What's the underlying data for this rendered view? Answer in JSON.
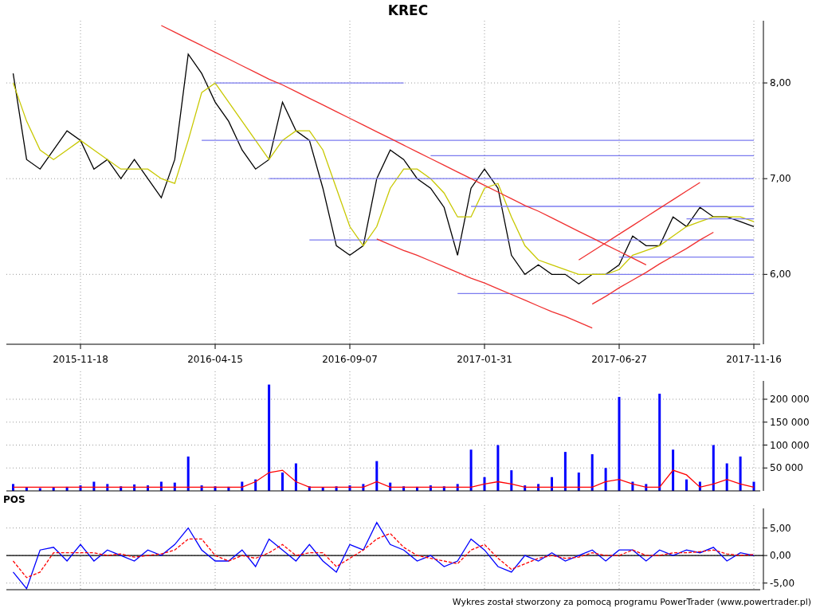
{
  "price": {
    "chart_data": {
      "type": "line",
      "title": "KREC",
      "grid": true,
      "categories": [
        null,
        null,
        null,
        null,
        null,
        "2015-11-18",
        null,
        null,
        null,
        null,
        null,
        null,
        null,
        null,
        null,
        "2016-04-15",
        null,
        null,
        null,
        null,
        null,
        null,
        null,
        null,
        null,
        "2016-09-07",
        null,
        null,
        null,
        null,
        null,
        null,
        null,
        null,
        null,
        "2017-01-31",
        null,
        null,
        null,
        null,
        null,
        null,
        null,
        null,
        null,
        "2017-06-27",
        null,
        null,
        null,
        null,
        null,
        null,
        null,
        null,
        null,
        "2017-11-16"
      ],
      "series": [
        {
          "color": "#000000",
          "values": [
            8.1,
            7.2,
            7.1,
            7.3,
            7.5,
            7.4,
            7.1,
            7.2,
            7.0,
            7.2,
            7.0,
            6.8,
            7.2,
            8.3,
            8.1,
            7.8,
            7.6,
            7.3,
            7.1,
            7.2,
            7.8,
            7.5,
            7.4,
            6.9,
            6.3,
            6.2,
            6.3,
            7.0,
            7.3,
            7.2,
            7.0,
            6.9,
            6.7,
            6.2,
            6.9,
            7.1,
            6.9,
            6.2,
            6.0,
            6.1,
            6.0,
            6.0,
            5.9,
            6.0,
            6.0,
            6.1,
            6.4,
            6.3,
            6.3,
            6.6,
            6.5,
            6.7,
            6.6,
            6.6,
            6.55,
            6.5
          ]
        },
        {
          "color": "#c8c800",
          "values": [
            8.0,
            7.6,
            7.3,
            7.2,
            7.3,
            7.4,
            7.3,
            7.2,
            7.1,
            7.1,
            7.1,
            7.0,
            6.95,
            7.4,
            7.9,
            8.0,
            7.8,
            7.6,
            7.4,
            7.2,
            7.4,
            7.5,
            7.5,
            7.3,
            6.9,
            6.5,
            6.3,
            6.5,
            6.9,
            7.1,
            7.1,
            7.0,
            6.85,
            6.6,
            6.6,
            6.9,
            6.95,
            6.6,
            6.3,
            6.15,
            6.1,
            6.05,
            6.0,
            6.0,
            6.0,
            6.05,
            6.2,
            6.25,
            6.3,
            6.4,
            6.5,
            6.55,
            6.6,
            6.6,
            6.6,
            6.55
          ]
        },
        {
          "color": "#7b7bf0",
          "values": [
            null,
            null,
            null,
            null,
            null,
            null,
            null,
            null,
            null,
            null,
            null,
            null,
            null,
            null,
            null,
            8.0,
            8.0,
            8.0,
            8.0,
            8.0,
            8.0,
            8.0,
            8.0,
            8.0,
            8.0,
            8.0,
            8.0,
            8.0,
            8.0,
            8.0,
            null,
            null,
            null,
            null,
            null,
            null,
            null,
            null,
            null,
            null,
            null,
            null,
            null,
            null,
            null,
            null,
            null,
            null,
            null,
            null,
            null,
            null,
            null,
            null,
            null,
            null
          ]
        },
        {
          "color": "#7b7bf0",
          "values": [
            null,
            null,
            null,
            null,
            null,
            null,
            null,
            null,
            null,
            null,
            null,
            null,
            null,
            null,
            7.4,
            7.4,
            7.4,
            7.4,
            7.4,
            7.4,
            7.4,
            7.4,
            7.4,
            7.4,
            7.4,
            7.4,
            7.4,
            7.4,
            7.4,
            7.4,
            7.4,
            7.4,
            7.4,
            7.4,
            7.4,
            7.4,
            7.4,
            7.4,
            7.4,
            7.4,
            7.4,
            7.4,
            7.4,
            7.4,
            7.4,
            7.4,
            7.4,
            7.4,
            7.4,
            7.4,
            7.4,
            7.4,
            7.4,
            7.4,
            7.4,
            7.4
          ]
        },
        {
          "color": "#7b7bf0",
          "values": [
            null,
            null,
            null,
            null,
            null,
            null,
            null,
            null,
            null,
            null,
            null,
            null,
            null,
            null,
            null,
            null,
            null,
            null,
            null,
            null,
            null,
            null,
            null,
            null,
            null,
            null,
            null,
            null,
            null,
            null,
            null,
            7.24,
            7.24,
            7.24,
            7.24,
            7.24,
            7.24,
            7.24,
            7.24,
            7.24,
            7.24,
            7.24,
            7.24,
            7.24,
            7.24,
            7.24,
            7.24,
            7.24,
            7.24,
            7.24,
            7.24,
            7.24,
            7.24,
            7.24,
            7.24,
            7.24
          ]
        },
        {
          "color": "#7b7bf0",
          "values": [
            null,
            null,
            null,
            null,
            null,
            null,
            null,
            null,
            null,
            null,
            null,
            null,
            null,
            null,
            null,
            null,
            null,
            null,
            null,
            7.0,
            7.0,
            7.0,
            7.0,
            7.0,
            7.0,
            7.0,
            7.0,
            7.0,
            7.0,
            7.0,
            7.0,
            7.0,
            7.0,
            7.0,
            7.0,
            7.0,
            7.0,
            7.0,
            7.0,
            7.0,
            7.0,
            7.0,
            7.0,
            7.0,
            7.0,
            7.0,
            7.0,
            7.0,
            7.0,
            7.0,
            7.0,
            7.0,
            7.0,
            7.0,
            7.0,
            7.0
          ]
        },
        {
          "color": "#7b7bf0",
          "values": [
            null,
            null,
            null,
            null,
            null,
            null,
            null,
            null,
            null,
            null,
            null,
            null,
            null,
            null,
            null,
            null,
            null,
            null,
            null,
            null,
            null,
            null,
            null,
            null,
            null,
            null,
            null,
            null,
            null,
            null,
            null,
            null,
            null,
            null,
            6.71,
            6.71,
            6.71,
            6.71,
            6.71,
            6.71,
            6.71,
            6.71,
            6.71,
            6.71,
            6.71,
            6.71,
            6.71,
            6.71,
            6.71,
            6.71,
            6.71,
            6.71,
            6.71,
            6.71,
            6.71,
            6.71
          ]
        },
        {
          "color": "#7b7bf0",
          "values": [
            null,
            null,
            null,
            null,
            null,
            null,
            null,
            null,
            null,
            null,
            null,
            null,
            null,
            null,
            null,
            null,
            null,
            null,
            null,
            null,
            null,
            null,
            null,
            null,
            null,
            null,
            null,
            null,
            null,
            null,
            null,
            null,
            null,
            null,
            null,
            null,
            null,
            null,
            null,
            null,
            null,
            null,
            null,
            null,
            null,
            null,
            null,
            null,
            null,
            null,
            6.58,
            6.58,
            6.58,
            6.58,
            6.58,
            6.58
          ]
        },
        {
          "color": "#7b7bf0",
          "values": [
            null,
            null,
            null,
            null,
            null,
            null,
            null,
            null,
            null,
            null,
            null,
            null,
            null,
            null,
            null,
            null,
            null,
            null,
            null,
            null,
            null,
            null,
            6.36,
            6.36,
            6.36,
            6.36,
            6.36,
            6.36,
            6.36,
            6.36,
            6.36,
            6.36,
            6.36,
            6.36,
            6.36,
            6.36,
            6.36,
            6.36,
            6.36,
            6.36,
            6.36,
            6.36,
            6.36,
            6.36,
            6.36,
            6.36,
            6.36,
            6.36,
            6.36,
            6.36,
            6.36,
            6.36,
            6.36,
            6.36,
            6.36,
            6.36
          ]
        },
        {
          "color": "#7b7bf0",
          "values": [
            null,
            null,
            null,
            null,
            null,
            null,
            null,
            null,
            null,
            null,
            null,
            null,
            null,
            null,
            null,
            null,
            null,
            null,
            null,
            null,
            null,
            null,
            null,
            null,
            null,
            null,
            null,
            null,
            null,
            null,
            null,
            null,
            null,
            null,
            null,
            null,
            null,
            null,
            null,
            null,
            null,
            null,
            null,
            null,
            null,
            6.18,
            6.18,
            6.18,
            6.18,
            6.18,
            6.18,
            6.18,
            6.18,
            6.18,
            6.18,
            6.18
          ]
        },
        {
          "color": "#7b7bf0",
          "values": [
            null,
            null,
            null,
            null,
            null,
            null,
            null,
            null,
            null,
            null,
            null,
            null,
            null,
            null,
            null,
            null,
            null,
            null,
            null,
            null,
            null,
            null,
            null,
            null,
            null,
            null,
            null,
            null,
            null,
            null,
            null,
            null,
            null,
            null,
            null,
            null,
            null,
            null,
            null,
            null,
            null,
            null,
            null,
            null,
            6.0,
            6.0,
            6.0,
            6.0,
            6.0,
            6.0,
            6.0,
            6.0,
            6.0,
            6.0,
            6.0,
            6.0
          ]
        },
        {
          "color": "#7b7bf0",
          "values": [
            null,
            null,
            null,
            null,
            null,
            null,
            null,
            null,
            null,
            null,
            null,
            null,
            null,
            null,
            null,
            null,
            null,
            null,
            null,
            null,
            null,
            null,
            null,
            null,
            null,
            null,
            null,
            null,
            null,
            null,
            null,
            null,
            null,
            5.8,
            5.8,
            5.8,
            5.8,
            5.8,
            5.8,
            5.8,
            5.8,
            5.8,
            5.8,
            5.8,
            5.8,
            5.8,
            5.8,
            5.8,
            5.8,
            5.8,
            5.8,
            5.8,
            5.8,
            5.8,
            5.8,
            5.8
          ]
        },
        {
          "color": "#f03030",
          "values": [
            null,
            null,
            null,
            null,
            null,
            null,
            null,
            null,
            null,
            null,
            null,
            8.6,
            8.53,
            8.46,
            8.39,
            8.32,
            8.25,
            8.18,
            8.11,
            8.04,
            7.98,
            7.91,
            7.84,
            7.77,
            7.7,
            7.63,
            7.56,
            7.49,
            7.42,
            7.35,
            7.28,
            7.21,
            7.14,
            7.07,
            7.0,
            6.93,
            6.86,
            6.79,
            6.72,
            6.66,
            6.59,
            6.52,
            6.45,
            6.38,
            6.31,
            6.24,
            6.17,
            6.1,
            null,
            null,
            null,
            null,
            null,
            null,
            null,
            null
          ]
        },
        {
          "color": "#f03030",
          "values": [
            null,
            null,
            null,
            null,
            null,
            null,
            null,
            null,
            null,
            null,
            null,
            null,
            null,
            null,
            null,
            null,
            null,
            null,
            null,
            null,
            null,
            null,
            null,
            null,
            null,
            null,
            null,
            6.37,
            6.31,
            6.25,
            6.2,
            6.14,
            6.08,
            6.02,
            5.96,
            5.91,
            5.85,
            5.79,
            5.73,
            5.67,
            5.61,
            5.56,
            5.5,
            5.44,
            null,
            null,
            null,
            null,
            null,
            null,
            null,
            null,
            null,
            null,
            null,
            null
          ]
        },
        {
          "color": "#f03030",
          "values": [
            null,
            null,
            null,
            null,
            null,
            null,
            null,
            null,
            null,
            null,
            null,
            null,
            null,
            null,
            null,
            null,
            null,
            null,
            null,
            null,
            null,
            null,
            null,
            null,
            null,
            null,
            null,
            null,
            null,
            null,
            null,
            null,
            null,
            null,
            null,
            null,
            null,
            null,
            null,
            null,
            null,
            null,
            6.15,
            6.24,
            6.33,
            6.42,
            6.51,
            6.6,
            6.69,
            6.78,
            6.87,
            6.96,
            null,
            null,
            null,
            null
          ]
        },
        {
          "color": "#f03030",
          "values": [
            null,
            null,
            null,
            null,
            null,
            null,
            null,
            null,
            null,
            null,
            null,
            null,
            null,
            null,
            null,
            null,
            null,
            null,
            null,
            null,
            null,
            null,
            null,
            null,
            null,
            null,
            null,
            null,
            null,
            null,
            null,
            null,
            null,
            null,
            null,
            null,
            null,
            null,
            null,
            null,
            null,
            null,
            null,
            5.69,
            5.77,
            5.86,
            5.94,
            6.02,
            6.11,
            6.19,
            6.27,
            6.36,
            6.44,
            null,
            null,
            null
          ]
        }
      ],
      "ylim": [
        5.27,
        8.65
      ],
      "yticks": [
        {
          "value": 6,
          "label": "6,00"
        },
        {
          "value": 7,
          "label": "7,00"
        },
        {
          "value": 8,
          "label": "8,00"
        }
      ]
    }
  },
  "volume": {
    "chart_data": {
      "type": "bar",
      "grid": true,
      "series": [
        {
          "color": "#0000ff",
          "values": [
            15000,
            8000,
            6000,
            7000,
            9000,
            12000,
            20000,
            15000,
            10000,
            14000,
            12000,
            20000,
            18000,
            75000,
            12000,
            10000,
            9000,
            20000,
            25000,
            232000,
            40000,
            60000,
            10000,
            8000,
            10000,
            12000,
            15000,
            65000,
            18000,
            10000,
            9000,
            12000,
            10000,
            15000,
            90000,
            30000,
            100000,
            45000,
            12000,
            15000,
            30000,
            85000,
            40000,
            80000,
            50000,
            205000,
            20000,
            15000,
            212000,
            90000,
            25000,
            20000,
            100000,
            60000,
            75000,
            20000
          ]
        },
        {
          "type": "line",
          "color": "#ff0000",
          "values": [
            8000,
            8000,
            8000,
            8000,
            8000,
            8000,
            8000,
            8000,
            8000,
            8000,
            8000,
            8000,
            8000,
            8000,
            8000,
            8000,
            8000,
            8000,
            20000,
            40000,
            45000,
            20000,
            8000,
            8000,
            8000,
            8000,
            8000,
            20000,
            8000,
            8000,
            8000,
            8000,
            8000,
            8000,
            8000,
            15000,
            20000,
            15000,
            8000,
            8000,
            8000,
            8000,
            8000,
            8000,
            20000,
            25000,
            15000,
            8000,
            8000,
            45000,
            35000,
            8000,
            15000,
            25000,
            15000,
            8000
          ]
        }
      ],
      "ylim": [
        0,
        240000
      ],
      "yticks": [
        {
          "value": 50000,
          "label": "50 000"
        },
        {
          "value": 100000,
          "label": "100 000"
        },
        {
          "value": 150000,
          "label": "150 000"
        },
        {
          "value": 200000,
          "label": "200 000"
        }
      ]
    }
  },
  "pos": {
    "chart_data": {
      "type": "line",
      "title": "POS",
      "grid": true,
      "series": [
        {
          "color": "#0000ff",
          "values": [
            -3,
            -6,
            1,
            1.5,
            -1,
            2,
            -1,
            1,
            0,
            -1,
            1,
            0,
            2,
            5,
            1,
            -1,
            -1,
            1,
            -2,
            3,
            1,
            -1,
            2,
            -1,
            -3,
            2,
            1,
            6,
            2,
            1,
            -1,
            0,
            -2,
            -1,
            3,
            1,
            -2,
            -3,
            0,
            -1,
            0.5,
            -1,
            0,
            1,
            -1,
            1,
            1,
            -1,
            1,
            0,
            1,
            0.5,
            1.5,
            -1,
            0.5,
            0
          ]
        },
        {
          "color": "#ff0000",
          "line_style": "dashed",
          "values": [
            -1,
            -4,
            -3,
            0.5,
            0.5,
            0.5,
            0.5,
            0,
            0.3,
            -0.3,
            0,
            0.3,
            1,
            3,
            3,
            0,
            -1,
            0,
            -0.5,
            0.5,
            2,
            0,
            0.5,
            0.5,
            -2,
            -0.5,
            1,
            3,
            4,
            1.5,
            0,
            -0.5,
            -1,
            -1.5,
            1,
            2,
            -0.5,
            -2.5,
            -1.5,
            -0.5,
            0,
            -0.5,
            -0.3,
            0.5,
            0,
            0,
            1,
            0,
            0,
            0.5,
            0.5,
            0.7,
            1,
            0.3,
            0,
            0.2
          ]
        }
      ],
      "ylim": [
        -6.2,
        8.55
      ],
      "yticks": [
        {
          "value": -5,
          "label": "-5,00"
        },
        {
          "value": 0,
          "label": "0,00"
        },
        {
          "value": 5,
          "label": "5,00"
        }
      ]
    }
  },
  "footer": "Wykres został stworzony za pomocą programu PowerTrader (www.powertrader.pl)"
}
